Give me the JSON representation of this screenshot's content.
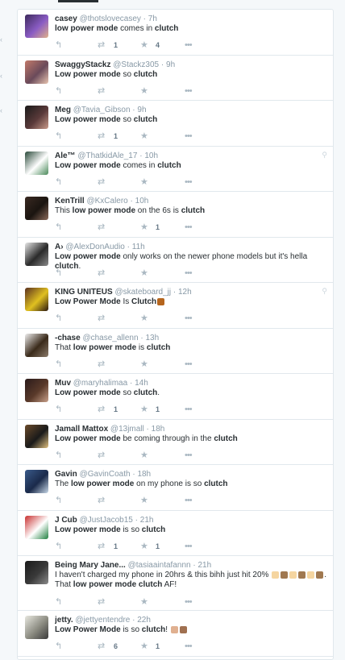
{
  "tweets": [
    {
      "name": "casey",
      "handle": "@thotslovecasey",
      "time": "7h",
      "parts": [
        [
          "b",
          "low power mode"
        ],
        [
          "t",
          " comes in "
        ],
        [
          "b",
          "clutch"
        ]
      ],
      "retweets": "1",
      "favorites": "4",
      "colors": [
        "#3d2a5c",
        "#8a5cc4",
        "#e0b08a"
      ]
    },
    {
      "name": "SwaggyStackz",
      "handle": "@Stackz305",
      "time": "9h",
      "parts": [
        [
          "b",
          "Low power mode"
        ],
        [
          "t",
          " so "
        ],
        [
          "b",
          "clutch"
        ]
      ],
      "retweets": "",
      "favorites": "",
      "colors": [
        "#c27a6a",
        "#6a4a5a",
        "#e8c4b0"
      ]
    },
    {
      "name": "Meg",
      "handle": "@Tavia_Gibson",
      "time": "9h",
      "parts": [
        [
          "b",
          "Low power mode"
        ],
        [
          "t",
          " so "
        ],
        [
          "b",
          "clutch"
        ]
      ],
      "retweets": "1",
      "favorites": "",
      "colors": [
        "#1a1a1a",
        "#5a3a3a",
        "#c89a8a"
      ]
    },
    {
      "name": "Ale™",
      "handle": "@ThatkidAle_17",
      "time": "10h",
      "parts": [
        [
          "b",
          "Low power mode"
        ],
        [
          "t",
          " comes in "
        ],
        [
          "b",
          "clutch"
        ]
      ],
      "retweets": "",
      "favorites": "",
      "colors": [
        "#2a4a3a",
        "#ffffff",
        "#4a8a5a"
      ],
      "pin": true
    },
    {
      "name": "KenTrill",
      "handle": "@KxCalero",
      "time": "10h",
      "parts": [
        [
          "t",
          "This "
        ],
        [
          "b",
          "low power mode"
        ],
        [
          "t",
          " on the 6s is "
        ],
        [
          "b",
          "clutch"
        ]
      ],
      "retweets": "",
      "favorites": "1",
      "colors": [
        "#3a2a22",
        "#1a1410",
        "#8a6a5a"
      ]
    },
    {
      "name": "A›",
      "handle": "@AlexDonAudio",
      "time": "11h",
      "parts": [
        [
          "b",
          "Low power mode"
        ],
        [
          "t",
          " only works on the newer phone models but it's hella "
        ],
        [
          "b",
          "clutch"
        ],
        [
          "t",
          "."
        ]
      ],
      "retweets": "",
      "favorites": "",
      "colors": [
        "#e8e8e8",
        "#2a2a2a",
        "#8a8a8a"
      ]
    },
    {
      "name": "KING UNITEUS",
      "handle": "@skateboard_jj",
      "time": "12h",
      "parts": [
        [
          "b",
          "Low Power Mode"
        ],
        [
          "t",
          " Is "
        ],
        [
          "b",
          "Clutch"
        ],
        [
          "e",
          "#b5651d"
        ]
      ],
      "retweets": "",
      "favorites": "",
      "colors": [
        "#5a3020",
        "#e0c020",
        "#2a1810"
      ],
      "pin": true
    },
    {
      "name": "-chase",
      "handle": "@chase_allenn",
      "time": "13h",
      "parts": [
        [
          "t",
          "That "
        ],
        [
          "b",
          "low power mode"
        ],
        [
          "t",
          " is "
        ],
        [
          "b",
          "clutch"
        ]
      ],
      "retweets": "",
      "favorites": "",
      "colors": [
        "#f0f0f0",
        "#3a2a1a",
        "#8a7a6a"
      ]
    },
    {
      "name": "Muv",
      "handle": "@maryhalimaa",
      "time": "14h",
      "parts": [
        [
          "b",
          "Low power mode"
        ],
        [
          "t",
          " so "
        ],
        [
          "b",
          "clutch"
        ],
        [
          "t",
          "."
        ]
      ],
      "retweets": "1",
      "favorites": "1",
      "colors": [
        "#2a1a1a",
        "#5a3a2a",
        "#c8a08a"
      ]
    },
    {
      "name": "Jamall Mattox",
      "handle": "@13jmall",
      "time": "18h",
      "parts": [
        [
          "b",
          "Low power mode"
        ],
        [
          "t",
          " be coming through in the "
        ],
        [
          "b",
          "clutch"
        ]
      ],
      "retweets": "",
      "favorites": "",
      "colors": [
        "#6a4a2a",
        "#1a1a1a",
        "#e0c080"
      ]
    },
    {
      "name": "Gavin",
      "handle": "@GavinCoath",
      "time": "18h",
      "parts": [
        [
          "t",
          "The "
        ],
        [
          "b",
          "low power mode"
        ],
        [
          "t",
          " on my phone is so "
        ],
        [
          "b",
          "clutch"
        ]
      ],
      "retweets": "",
      "favorites": "",
      "colors": [
        "#3a5a8a",
        "#1a2a4a",
        "#c8d8e8"
      ]
    },
    {
      "name": "J Cub",
      "handle": "@JustJacob15",
      "time": "21h",
      "parts": [
        [
          "b",
          "Low power mode"
        ],
        [
          "t",
          " is so "
        ],
        [
          "b",
          "clutch"
        ]
      ],
      "retweets": "1",
      "favorites": "1",
      "colors": [
        "#c83030",
        "#ffffff",
        "#208040"
      ]
    },
    {
      "name": "Being Mary Jane...",
      "handle": "@tasiaaintafannn",
      "time": "21h",
      "parts": [
        [
          "t",
          "I haven't charged my phone in 20hrs & this bihh just hit 20% "
        ],
        [
          "e",
          "#f5d5a0"
        ],
        [
          "e",
          "#a07850"
        ],
        [
          "e",
          "#f5d5a0"
        ],
        [
          "e",
          "#a07850"
        ],
        [
          "e",
          "#f5d5a0"
        ],
        [
          "e",
          "#a07850"
        ],
        [
          "t",
          ". That "
        ],
        [
          "b",
          "low power mode clutch"
        ],
        [
          "t",
          " AF!"
        ]
      ],
      "retweets": "",
      "favorites": "",
      "colors": [
        "#1a1a1a",
        "#3a3a3a",
        "#8a8a8a"
      ],
      "tall": true
    },
    {
      "name": "jetty.",
      "handle": "@jettyentendre",
      "time": "22h",
      "parts": [
        [
          "b",
          "Low Power Mode"
        ],
        [
          "t",
          " is so "
        ],
        [
          "b",
          "clutch"
        ],
        [
          "t",
          "! "
        ],
        [
          "e",
          "#e0b090"
        ],
        [
          "e",
          "#a07050"
        ]
      ],
      "retweets": "6",
      "favorites": "1",
      "colors": [
        "#e8e8e0",
        "#8a8a80",
        "#3a3a3a"
      ]
    }
  ],
  "icons": {
    "reply": "reply-icon",
    "retweet": "retweet-icon",
    "favorite": "favorite-icon",
    "more": "more-icon",
    "location": "location-icon"
  }
}
